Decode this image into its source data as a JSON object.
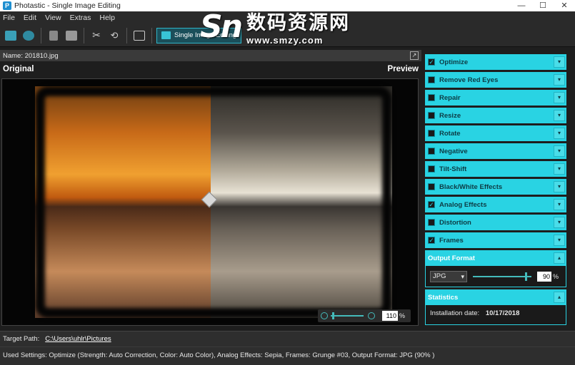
{
  "window": {
    "title": "Photastic - Single Image Editing",
    "app_icon": "photastic-app-icon",
    "controls": [
      "—",
      "☐",
      "✕"
    ]
  },
  "menu": [
    "File",
    "Edit",
    "View",
    "Extras",
    "Help"
  ],
  "toolbar": {
    "icons": [
      "open-image-icon",
      "batch-icon",
      "save-icon",
      "print-icon",
      "cut-icon",
      "crop-icon",
      "fullscreen-icon"
    ],
    "mode_label": "Single Image Editing"
  },
  "watermark": {
    "cn": "数码资源网",
    "url": "www.smzy.com"
  },
  "image": {
    "name_label": "Name: 201810.jpg",
    "original_label": "Original",
    "preview_label": "Preview",
    "zoom_value": "110",
    "zoom_unit": "%"
  },
  "panels": [
    {
      "label": "Optimize",
      "checked": true
    },
    {
      "label": "Remove Red Eyes",
      "checked": false
    },
    {
      "label": "Repair",
      "checked": false
    },
    {
      "label": "Resize",
      "checked": false
    },
    {
      "label": "Rotate",
      "checked": false
    },
    {
      "label": "Negative",
      "checked": false
    },
    {
      "label": "Tilt-Shift",
      "checked": false
    },
    {
      "label": "Black/White Effects",
      "checked": false
    },
    {
      "label": "Analog Effects",
      "checked": true
    },
    {
      "label": "Distortion",
      "checked": false
    },
    {
      "label": "Frames",
      "checked": true
    }
  ],
  "output_format": {
    "title": "Output Format",
    "format": "JPG",
    "quality": "90",
    "quality_unit": "%"
  },
  "statistics": {
    "title": "Statistics",
    "installation_label": "Installation date:",
    "installation_value": "10/17/2018"
  },
  "status": {
    "target_label": "Target Path:",
    "target_path": "C:\\Users\\uhlr\\Pictures",
    "used_settings": "Used Settings: Optimize (Strength: Auto Correction, Color: Auto Color), Analog Effects: Sepia, Frames: Grunge #03, Output Format: JPG (90% )"
  },
  "colors": {
    "accent": "#29d3e3",
    "background": "#1e1e1e"
  }
}
